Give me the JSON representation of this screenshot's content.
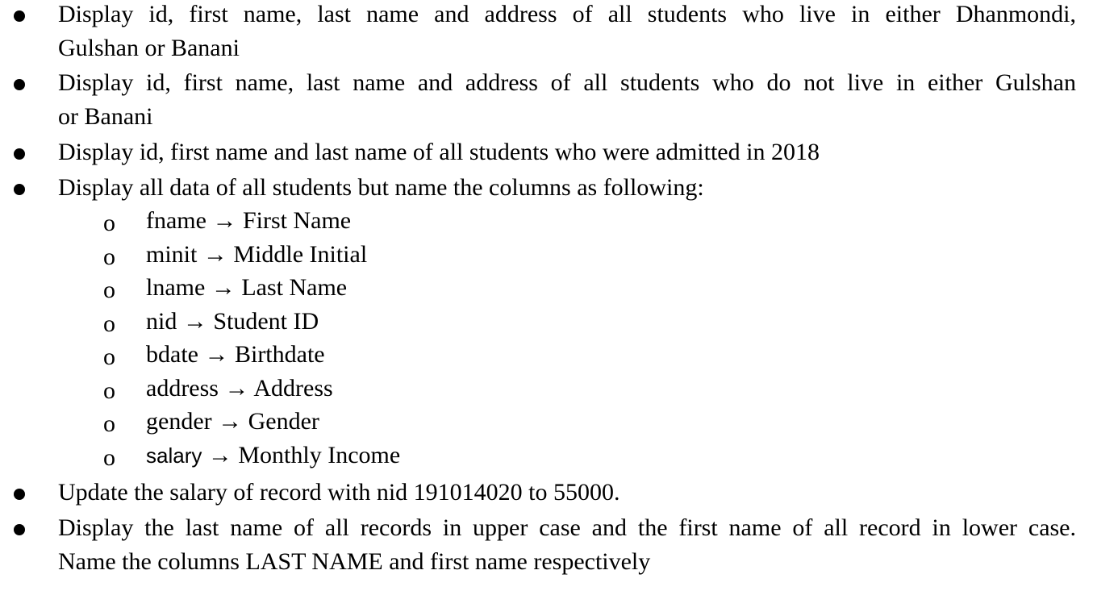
{
  "bullets": [
    {
      "line1": "Display id, first name, last name and address of all students who live in either Dhanmondi,",
      "line2": "Gulshan or Banani"
    },
    {
      "line1": "Display id, first name, last name and address of all students who do not live in either Gulshan",
      "line2": "or Banani"
    },
    {
      "line1": "Display id, first name and last name of all students who were admitted in 2018"
    },
    {
      "line1": "Display all data of all students but name the columns as following:",
      "sub_items": [
        {
          "marker": "o",
          "source": "fname",
          "arrow": "→",
          "target": "First Name"
        },
        {
          "marker": "o",
          "source": "minit",
          "arrow": "→",
          "target": "Middle Initial"
        },
        {
          "marker": "o",
          "source": "lname",
          "arrow": "→",
          "target": "Last Name"
        },
        {
          "marker": "o",
          "source": "nid",
          "arrow": "→",
          "target": "Student ID"
        },
        {
          "marker": "o",
          "source": "bdate",
          "arrow": "→",
          "target": "Birthdate"
        },
        {
          "marker": "o",
          "source": "address",
          "arrow": "→",
          "target": "Address"
        },
        {
          "marker": "o",
          "source": "gender",
          "arrow": "→",
          "target": "Gender"
        },
        {
          "marker": "o",
          "source": "salary",
          "arrow": "→",
          "target": "Monthly Income"
        }
      ]
    },
    {
      "line1": "Update the salary of record with nid 191014020 to 55000."
    },
    {
      "line1": "Display the last name of all records in upper case and the first name of all record in lower case.",
      "line2": "Name the columns LAST NAME and first name respectively"
    }
  ]
}
